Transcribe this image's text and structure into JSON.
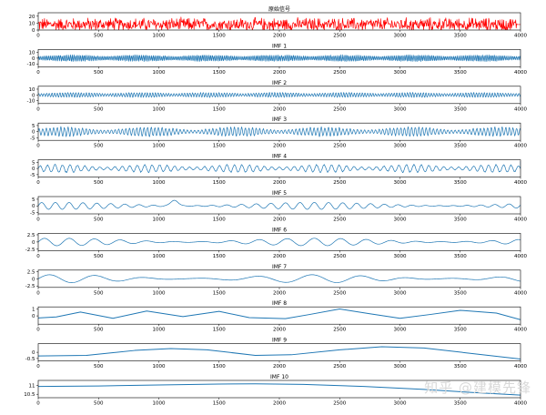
{
  "watermark": "知乎 @建模先锋",
  "chart_data": [
    {
      "type": "line",
      "title": "原始信号",
      "xlim": [
        0,
        4000
      ],
      "ylim": [
        0,
        25
      ],
      "yticks": [
        0,
        10,
        20
      ],
      "xticks": [
        0,
        500,
        1000,
        1500,
        2000,
        2500,
        3000,
        3500,
        4000
      ],
      "color": "#ff0000",
      "signal": {
        "kind": "noise",
        "center": 8,
        "amplitude": 14,
        "floor": 0,
        "points": 1000,
        "tail_value": 8
      }
    },
    {
      "type": "line",
      "title": "IMF 1",
      "xlim": [
        0,
        4000
      ],
      "ylim": [
        -15,
        15
      ],
      "yticks": [
        -10,
        0,
        10
      ],
      "xticks": [
        0,
        500,
        1000,
        1500,
        2000,
        2500,
        3000,
        3500,
        4000
      ],
      "color": "#1f77b4",
      "signal": {
        "kind": "hf",
        "amplitude": 6,
        "period": 14,
        "points": 1400,
        "end_spike": 14
      }
    },
    {
      "type": "line",
      "title": "IMF 2",
      "xlim": [
        0,
        4000
      ],
      "ylim": [
        -15,
        15
      ],
      "yticks": [
        -10,
        0,
        10
      ],
      "xticks": [
        0,
        500,
        1000,
        1500,
        2000,
        2500,
        3000,
        3500,
        4000
      ],
      "color": "#1f77b4",
      "signal": {
        "kind": "hf",
        "amplitude": 4.5,
        "period": 22,
        "points": 1200,
        "end_spike": -12
      }
    },
    {
      "type": "line",
      "title": "IMF 3",
      "xlim": [
        0,
        4000
      ],
      "ylim": [
        -7,
        7
      ],
      "yticks": [
        -5,
        0,
        5
      ],
      "xticks": [
        0,
        500,
        1000,
        1500,
        2000,
        2500,
        3000,
        3500,
        4000
      ],
      "color": "#1f77b4",
      "signal": {
        "kind": "burst",
        "amplitude": 3.5,
        "period": 30,
        "points": 1000
      }
    },
    {
      "type": "line",
      "title": "IMF 4",
      "xlim": [
        0,
        4000
      ],
      "ylim": [
        -7,
        7
      ],
      "yticks": [
        -5,
        0,
        5
      ],
      "xticks": [
        0,
        500,
        1000,
        1500,
        2000,
        2500,
        3000,
        3500,
        4000
      ],
      "color": "#1f77b4",
      "signal": {
        "kind": "burst",
        "amplitude": 3,
        "period": 62,
        "points": 900,
        "end_spike": 6
      }
    },
    {
      "type": "line",
      "title": "IMF 5",
      "xlim": [
        0,
        4000
      ],
      "ylim": [
        -6,
        7
      ],
      "yticks": [
        -5,
        0,
        5
      ],
      "xticks": [
        0,
        500,
        1000,
        1500,
        2000,
        2500,
        3000,
        3500,
        4000
      ],
      "color": "#1f77b4",
      "signal": {
        "kind": "smooth",
        "amplitude": 2.6,
        "period": 118,
        "points": 800,
        "bump_at": 1130,
        "bump": 4.5
      }
    },
    {
      "type": "line",
      "title": "IMF 6",
      "xlim": [
        0,
        4000
      ],
      "ylim": [
        -3,
        3
      ],
      "yticks": [
        -2.5,
        0,
        2.5
      ],
      "xticks": [
        0,
        500,
        1000,
        1500,
        2000,
        2500,
        3000,
        3500,
        4000
      ],
      "color": "#1f77b4",
      "signal": {
        "kind": "smooth",
        "amplitude": 1.3,
        "period": 220,
        "points": 600
      }
    },
    {
      "type": "line",
      "title": "IMF 7",
      "xlim": [
        0,
        4000
      ],
      "ylim": [
        -3,
        3
      ],
      "yticks": [
        -2.5,
        0,
        2.5
      ],
      "xticks": [
        0,
        500,
        1000,
        1500,
        2000,
        2500,
        3000,
        3500,
        4000
      ],
      "color": "#1f77b4",
      "signal": {
        "kind": "smooth",
        "amplitude": 1.4,
        "period": 420,
        "points": 500
      }
    },
    {
      "type": "line",
      "title": "IMF 8",
      "xlim": [
        0,
        4000
      ],
      "ylim": [
        -1.2,
        1.3
      ],
      "yticks": [
        0,
        1
      ],
      "xticks": [
        0,
        500,
        1000,
        1500,
        2000,
        2500,
        3000,
        3500,
        4000
      ],
      "color": "#1f77b4",
      "signal": {
        "kind": "points",
        "x": [
          0,
          150,
          350,
          620,
          900,
          1200,
          1500,
          1750,
          2050,
          2250,
          2500,
          2750,
          3000,
          3250,
          3500,
          3800,
          4000
        ],
        "y": [
          -0.3,
          -0.15,
          0.55,
          -0.35,
          0.7,
          -0.1,
          0.65,
          -0.25,
          -0.4,
          0.2,
          1.0,
          0.3,
          -0.35,
          0.2,
          0.8,
          0.4,
          -0.55
        ]
      }
    },
    {
      "type": "line",
      "title": "IMF 9",
      "xlim": [
        0,
        4000
      ],
      "ylim": [
        -0.7,
        0.7
      ],
      "yticks": [
        -0.5,
        0.0
      ],
      "xticks": [
        0,
        500,
        1000,
        1500,
        2000,
        2500,
        3000,
        3500,
        4000
      ],
      "color": "#1f77b4",
      "signal": {
        "kind": "points",
        "x": [
          0,
          400,
          800,
          1100,
          1400,
          1800,
          2100,
          2500,
          2850,
          3200,
          3600,
          4000
        ],
        "y": [
          -0.3,
          -0.25,
          0.15,
          0.3,
          0.2,
          -0.25,
          -0.2,
          0.2,
          0.45,
          0.35,
          -0.1,
          -0.55
        ]
      }
    },
    {
      "type": "line",
      "title": "IMF 10",
      "xlim": [
        0,
        4000
      ],
      "ylim": [
        10.3,
        11.3
      ],
      "yticks": [
        10.5,
        11.0
      ],
      "xticks": [
        0,
        500,
        1000,
        1500,
        2000,
        2500,
        3000,
        3500,
        4000
      ],
      "color": "#1f77b4",
      "signal": {
        "kind": "points",
        "x": [
          0,
          500,
          1000,
          1500,
          1800,
          2200,
          2700,
          3200,
          3600,
          4000
        ],
        "y": [
          10.95,
          10.98,
          11.04,
          11.09,
          11.1,
          11.07,
          10.95,
          10.78,
          10.6,
          10.45
        ]
      }
    }
  ]
}
